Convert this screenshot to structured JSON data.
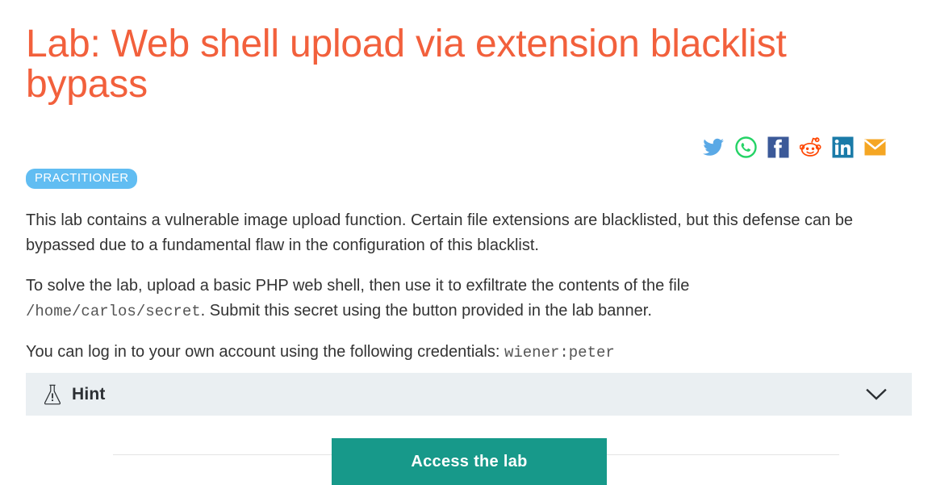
{
  "page": {
    "title": "Lab: Web shell upload via extension blacklist bypass",
    "background_color": "#ffffff",
    "accent_color": "#f2603c"
  },
  "share": {
    "items": [
      {
        "name": "twitter-icon",
        "label": "Share on Twitter",
        "color": "#5aa9e6"
      },
      {
        "name": "whatsapp-icon",
        "label": "Share on WhatsApp",
        "color": "#25d366"
      },
      {
        "name": "facebook-icon",
        "label": "Share on Facebook",
        "color": "#3b5998"
      },
      {
        "name": "reddit-icon",
        "label": "Share on Reddit",
        "color": "#ff4500"
      },
      {
        "name": "linkedin-icon",
        "label": "Share on LinkedIn",
        "color": "#1a7ba8"
      },
      {
        "name": "email-icon",
        "label": "Share via Email",
        "color": "#f5a623"
      }
    ]
  },
  "badge": {
    "label": "PRACTITIONER",
    "color": "#61bdf2",
    "text_color": "#ffffff"
  },
  "description": {
    "paragraph_1": "This lab contains a vulnerable image upload function. Certain file extensions are blacklisted, but this defense can be bypassed due to a fundamental flaw in the configuration of this blacklist.",
    "paragraph_2_part_1": "To solve the lab, upload a basic PHP web shell, then use it to exfiltrate the contents of the file ",
    "paragraph_2_code": "/home/carlos/secret",
    "paragraph_2_part_2": ". Submit this secret using the button provided in the lab banner.",
    "paragraph_3_part_1": "You can log in to your own account using the following credentials: ",
    "paragraph_3_code": "wiener:peter"
  },
  "hint": {
    "label": "Hint",
    "icon": "flask-icon",
    "expand_icon": "chevron-down-icon",
    "expanded": false,
    "background_color": "#eaeff2"
  },
  "cta": {
    "label": "Access the lab",
    "color": "#17998a",
    "text_color": "#ffffff"
  }
}
